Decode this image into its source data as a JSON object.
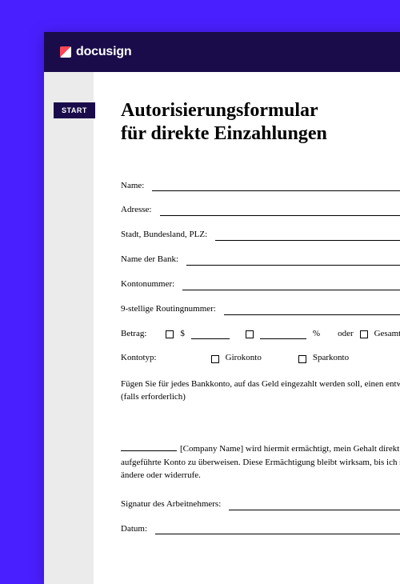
{
  "brand": {
    "name": "docusign"
  },
  "startLabel": "START",
  "title_l1": "Autorisierungsformular",
  "title_l2": "für direkte Einzahlungen",
  "fields": {
    "name": "Name:",
    "address": "Adresse:",
    "cityStateZip": "Stadt, Bundesland, PLZ:",
    "bankName": "Name der Bank:",
    "accountNumber": "Kontonummer:",
    "routing": "9-stellige Routingnummer:"
  },
  "amount": {
    "label": "Betrag:",
    "dollar": "$",
    "percent": "%",
    "or": "oder",
    "fullSalary": "Gesamtes Gehalt"
  },
  "accountType": {
    "label": "Kontotyp:",
    "checking": "Girokonto",
    "savings": "Sparkonto"
  },
  "note": "Fügen Sie für jedes Bankkonto, auf das Geld eingezahlt werden soll, einen entwerteten Scheck an (falls erforderlich)",
  "auth": {
    "companyPlaceholder": "[Company Name]",
    "text": " wird hiermit ermächtigt, mein Gehalt direkt auf das oben aufgeführte Konto zu überweisen. Diese Ermächtigung bleibt wirksam, bis ich sie schriftlich ändere oder widerrufe."
  },
  "signature": "Signatur des Arbeitnehmers:",
  "date": "Datum:"
}
